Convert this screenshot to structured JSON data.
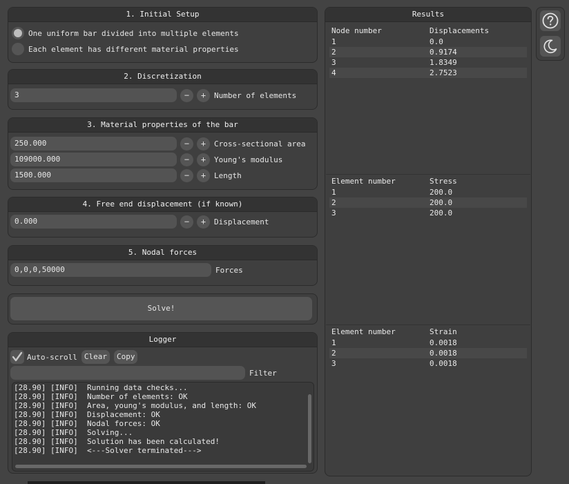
{
  "setup": {
    "title": "1. Initial Setup",
    "options": [
      {
        "label": "One uniform bar divided into multiple elements",
        "selected": true
      },
      {
        "label": "Each element has different material properties",
        "selected": false
      }
    ]
  },
  "discretization": {
    "title": "2. Discretization",
    "value": "3",
    "label": "Number of elements"
  },
  "material": {
    "title": "3. Material properties of the bar",
    "fields": [
      {
        "value": "250.000",
        "label": "Cross-sectional area"
      },
      {
        "value": "109000.000",
        "label": "Young's modulus"
      },
      {
        "value": "1500.000",
        "label": "Length"
      }
    ]
  },
  "displacement": {
    "title": "4. Free end displacement (if known)",
    "value": "0.000",
    "label": "Displacement"
  },
  "forces": {
    "title": "5. Nodal forces",
    "value": "0,0,0,50000",
    "label": "Forces"
  },
  "solve": {
    "label": "Solve!"
  },
  "stepper": {
    "minus": "−",
    "plus": "+"
  },
  "logger": {
    "title": "Logger",
    "autoscroll_label": "Auto-scroll",
    "clear_label": "Clear",
    "copy_label": "Copy",
    "filter_label": "Filter",
    "filter_value": "",
    "lines": [
      "[28.90] [INFO]  Running data checks...",
      "[28.90] [INFO]  Number of elements: OK",
      "[28.90] [INFO]  Area, young's modulus, and length: OK",
      "[28.90] [INFO]  Displacement: OK",
      "[28.90] [INFO]  Nodal forces: OK",
      "[28.90] [INFO]  Solving...",
      "[28.90] [INFO]  Solution has been calculated!",
      "[28.90] [INFO]  <---Solver terminated--->"
    ]
  },
  "results": {
    "title": "Results",
    "displacements": {
      "headers": [
        "Node number",
        "Displacements"
      ],
      "rows": [
        [
          "1",
          "0.0"
        ],
        [
          "2",
          "0.9174"
        ],
        [
          "3",
          "1.8349"
        ],
        [
          "4",
          "2.7523"
        ]
      ]
    },
    "stress": {
      "headers": [
        "Element number",
        "Stress"
      ],
      "rows": [
        [
          "1",
          "200.0"
        ],
        [
          "2",
          "200.0"
        ],
        [
          "3",
          "200.0"
        ]
      ]
    },
    "strain": {
      "headers": [
        "Element number",
        "Strain"
      ],
      "rows": [
        [
          "1",
          "0.0018"
        ],
        [
          "2",
          "0.0018"
        ],
        [
          "3",
          "0.0018"
        ]
      ]
    }
  },
  "sidebar": {
    "help_icon": "question-circle-icon",
    "theme_icon": "crescent-moon-icon"
  },
  "colors": {
    "background": "#434343",
    "panel": "#3f3f3f",
    "title_bar": "#333333",
    "input": "#535353"
  }
}
